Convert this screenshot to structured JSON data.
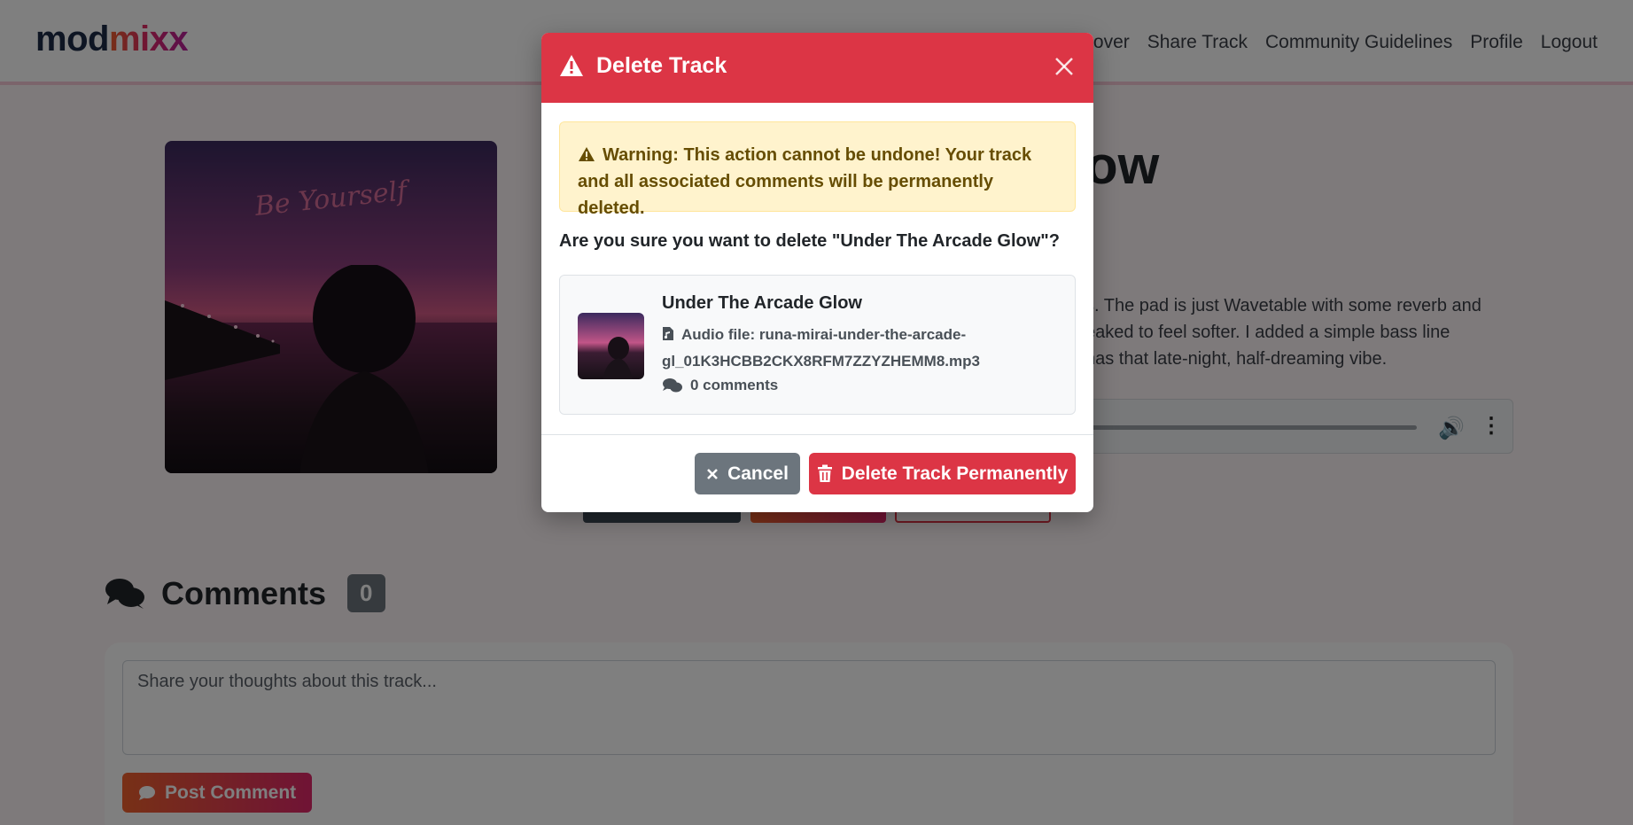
{
  "navbar": {
    "brand_part1": "mod",
    "brand_part2": "mixx",
    "links": [
      "over",
      "Share Track",
      "Community Guidelines",
      "Profile",
      "Logout"
    ]
  },
  "track": {
    "cover_text": "Be Yourself",
    "title_partial": "ow",
    "description_lines": [
      "s. The pad is just Wavetable with some reverb and",
      "eaked to feel softer. I added a simple bass line",
      "has that late-night, half-dreaming vibe."
    ]
  },
  "comments": {
    "heading": "Comments",
    "count": "0",
    "placeholder": "Share your thoughts about this track...",
    "post_label": "Post Comment"
  },
  "modal": {
    "title": "Delete Track",
    "warning": "Warning: This action cannot be undone! Your track and all associated comments will be permanently deleted.",
    "question": "Are you sure you want to delete \"Under The Arcade Glow\"?",
    "track_title": "Under The Arcade Glow",
    "audio_file_text": "Audio file: runa-mirai-under-the-arcade-gl_01K3HCBB2CKX8RFM7ZZYZHEMM8.mp3",
    "comments_text": "0 comments",
    "cancel_label": "Cancel",
    "delete_label": "Delete Track Permanently"
  },
  "colors": {
    "danger": "#dc3545",
    "secondary": "#6c757d",
    "warning_bg": "#fff3cd",
    "brand_gradient_start": "#f0612d",
    "brand_gradient_end": "#e0276a"
  }
}
